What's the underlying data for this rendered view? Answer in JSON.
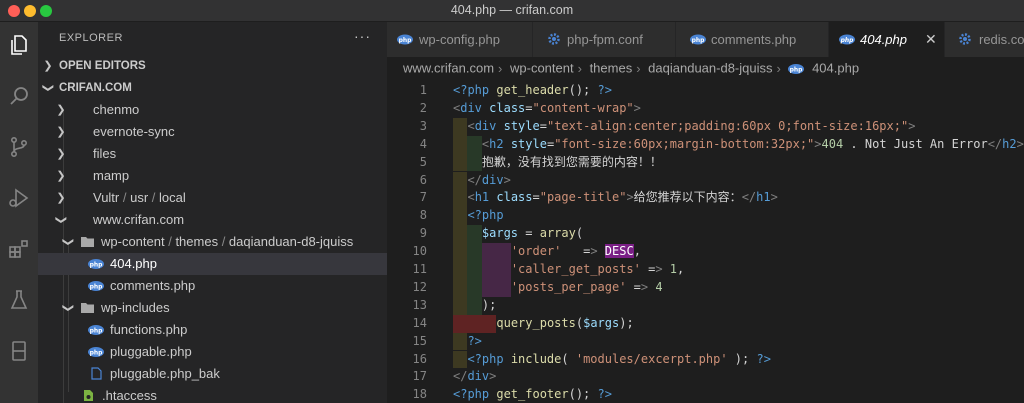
{
  "window": {
    "title": "404.php — crifan.com"
  },
  "sidebar": {
    "title": "EXPLORER",
    "more": "···",
    "sections": {
      "open_editors": "OPEN EDITORS",
      "workspace": "CRIFAN.COM"
    },
    "folders": [
      "chenmo",
      "evernote-sync",
      "files",
      "mamp"
    ],
    "vultr_path": [
      "Vultr",
      "usr",
      "local"
    ],
    "www": "www.crifan.com",
    "wp_content_path": [
      "wp-content",
      "themes",
      "daqianduan-d8-jquiss"
    ],
    "theme_files": [
      "404.php",
      "comments.php"
    ],
    "wp_includes": "wp-includes",
    "include_files": [
      "functions.php",
      "pluggable.php",
      "pluggable.php_bak"
    ],
    "htaccess": ".htaccess"
  },
  "tabs": [
    {
      "label": "wp-config.php",
      "icon": "php-icon"
    },
    {
      "label": "php-fpm.conf",
      "icon": "gear-icon"
    },
    {
      "label": "comments.php",
      "icon": "php-icon"
    },
    {
      "label": "404.php",
      "icon": "php-icon",
      "active": true
    },
    {
      "label": "redis.conf",
      "icon": "gear-icon"
    }
  ],
  "breadcrumb": [
    "www.crifan.com",
    "wp-content",
    "themes",
    "daqianduan-d8-jquiss",
    "404.php"
  ],
  "editor": {
    "line_numbers": [
      "1",
      "2",
      "3",
      "4",
      "5",
      "6",
      "7",
      "8",
      "9",
      "10",
      "11",
      "12",
      "13",
      "14",
      "15",
      "16",
      "17",
      "18"
    ],
    "lines": [
      "<?php get_header(); ?>",
      "<div class=\"content-wrap\">",
      "<div style=\"text-align:center;padding:60px 0;font-size:16px;\">",
      "<h2 style=\"font-size:60px;margin-bottom:32px;\">404 . Not Just An Error</h2>",
      "抱歉，没有找到您需要的内容！！",
      "</div>",
      "<h1 class=\"page-title\">给您推荐以下内容：</h1>",
      "<?php",
      "$args = array(",
      "'order'   => DESC,",
      "'caller_get_posts' => 1,",
      "'posts_per_page' => 4",
      ");",
      "query_posts($args);",
      "?>",
      "<?php include( 'modules/excerpt.php' ); ?>",
      "</div>",
      "<?php get_footer(); ?>"
    ]
  },
  "colors": {
    "background": "#1e1e1e",
    "sidebar": "#252526",
    "activity_bar": "#333333",
    "selection": "#37373d",
    "php_icon": "#4a84d4"
  }
}
